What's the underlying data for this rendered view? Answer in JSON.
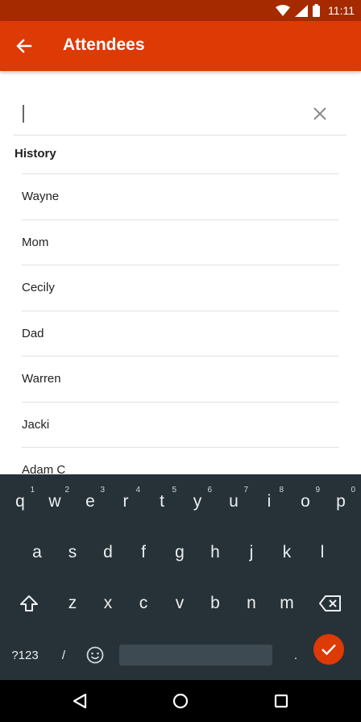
{
  "status": {
    "time": "11:11"
  },
  "header": {
    "title": "Attendees",
    "back_icon": "arrow-back-icon"
  },
  "search": {
    "value": "",
    "placeholder": ""
  },
  "history": {
    "label": "History",
    "items": [
      "Wayne",
      "Mom",
      "Cecily",
      "Dad",
      "Warren",
      "Jacki",
      "Adam C"
    ]
  },
  "keyboard": {
    "row1": [
      {
        "k": "q",
        "h": "1"
      },
      {
        "k": "w",
        "h": "2"
      },
      {
        "k": "e",
        "h": "3"
      },
      {
        "k": "r",
        "h": "4"
      },
      {
        "k": "t",
        "h": "5"
      },
      {
        "k": "y",
        "h": "6"
      },
      {
        "k": "u",
        "h": "7"
      },
      {
        "k": "i",
        "h": "8"
      },
      {
        "k": "o",
        "h": "9"
      },
      {
        "k": "p",
        "h": "0"
      }
    ],
    "row2": [
      "a",
      "s",
      "d",
      "f",
      "g",
      "h",
      "j",
      "k",
      "l"
    ],
    "row3": [
      "z",
      "x",
      "c",
      "v",
      "b",
      "n",
      "m"
    ],
    "sym_label": "?123",
    "slash": "/",
    "period": "."
  },
  "colors": {
    "accent": "#dd3a05",
    "status_bar": "#a52a00",
    "keyboard_bg": "#263238"
  }
}
